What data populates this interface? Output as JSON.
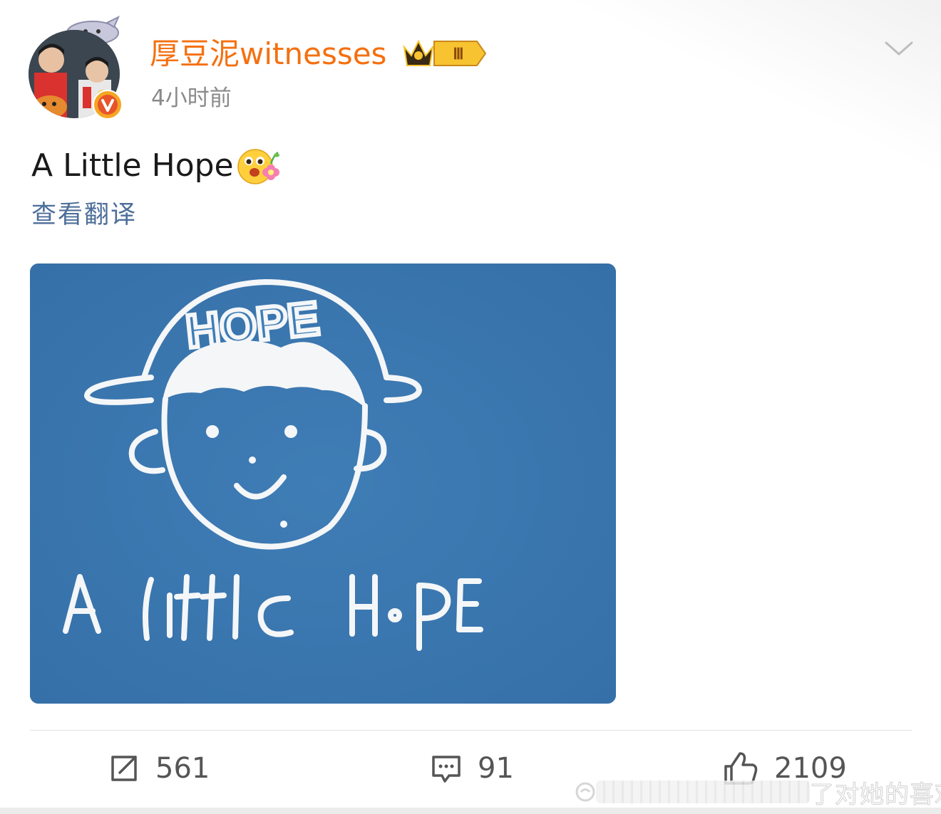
{
  "post": {
    "username": "厚豆泥witnesses",
    "timestamp": "4小时前",
    "text": "A Little Hope",
    "translate_label": "查看翻译",
    "vip_level": "Ⅲ",
    "verified_mark": "V",
    "image": {
      "cap_text": "HOPE",
      "caption_text": "A little HoPE"
    }
  },
  "actions": {
    "repost_count": "561",
    "comment_count": "91",
    "like_count": "2109"
  },
  "watermark": {
    "text": "了对她的喜欢"
  },
  "icons": {
    "avatar": "avatar-photo",
    "verified": "verified-v-icon",
    "vip": "vip-crown-badge-icon",
    "more": "chevron-down-icon",
    "emoji": "flower-face-emoji",
    "repost": "repost-icon",
    "comment": "comment-icon",
    "like": "thumbs-up-icon"
  },
  "colors": {
    "username": "#f57010",
    "link": "#4d6e99",
    "image_bg": "#3a76ae",
    "text": "#1a1a1a",
    "muted": "#8a8a8a"
  }
}
